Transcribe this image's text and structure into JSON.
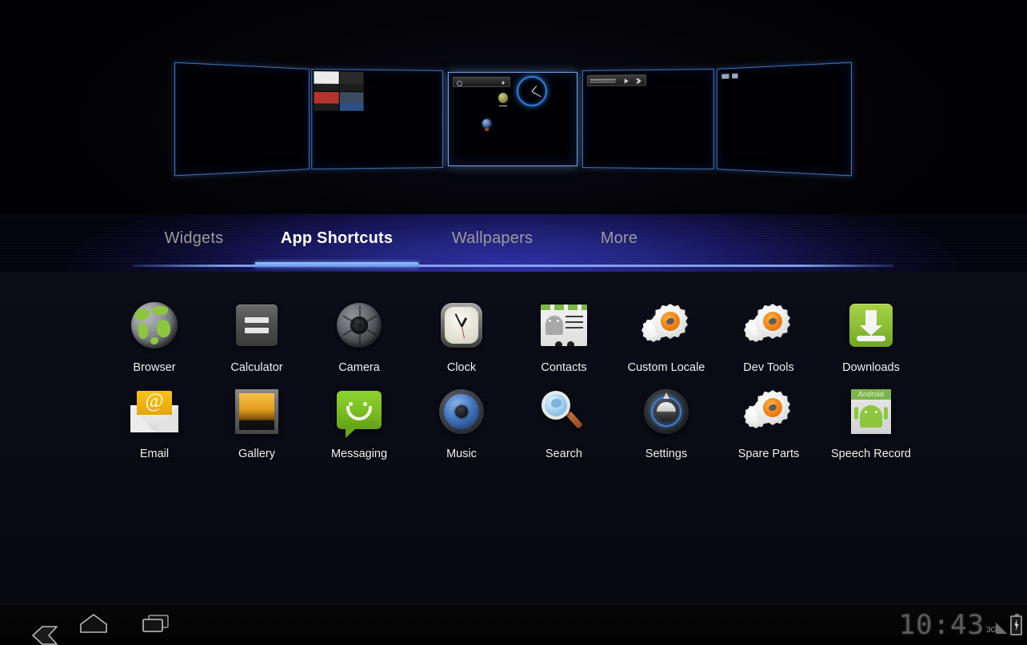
{
  "workspace": {
    "panels": [
      {
        "name": "panel-empty-left",
        "selected": false,
        "widgets": []
      },
      {
        "name": "panel-bookmarks",
        "selected": false,
        "widgets": [
          "bookmarks-grid"
        ]
      },
      {
        "name": "panel-home-current",
        "selected": true,
        "widgets": [
          "search-bar",
          "analog-clock-widget",
          "globe-icon",
          "browser-shortcut"
        ]
      },
      {
        "name": "panel-music",
        "selected": false,
        "widgets": [
          "music-player-widget"
        ]
      },
      {
        "name": "panel-empty-right",
        "selected": false,
        "widgets": []
      }
    ],
    "accent_color": "#3f6fb5",
    "selected_accent_color": "#6ea4e8"
  },
  "tabs": {
    "items": [
      {
        "label": "Widgets",
        "active": false
      },
      {
        "label": "App Shortcuts",
        "active": true
      },
      {
        "label": "Wallpapers",
        "active": false
      },
      {
        "label": "More",
        "active": false
      }
    ],
    "active_color": "#ffffff",
    "inactive_color": "#9b9b9b",
    "underline_color": "#7fb0f5"
  },
  "apps": {
    "rows": [
      [
        {
          "label": "Browser",
          "icon": "browser-icon"
        },
        {
          "label": "Calculator",
          "icon": "calculator-icon"
        },
        {
          "label": "Camera",
          "icon": "camera-icon"
        },
        {
          "label": "Clock",
          "icon": "clock-icon"
        },
        {
          "label": "Contacts",
          "icon": "contacts-icon"
        },
        {
          "label": "Custom Locale",
          "icon": "gear-icon"
        },
        {
          "label": "Dev Tools",
          "icon": "gear-icon"
        },
        {
          "label": "Downloads",
          "icon": "download-icon"
        }
      ],
      [
        {
          "label": "Email",
          "icon": "email-icon"
        },
        {
          "label": "Gallery",
          "icon": "gallery-icon"
        },
        {
          "label": "Messaging",
          "icon": "message-icon"
        },
        {
          "label": "Music",
          "icon": "music-icon"
        },
        {
          "label": "Search",
          "icon": "search-icon"
        },
        {
          "label": "Settings",
          "icon": "settings-icon"
        },
        {
          "label": "Spare Parts",
          "icon": "gear-icon"
        },
        {
          "label": "Speech Record",
          "icon": "android-app-icon"
        }
      ]
    ]
  },
  "widget_previews": {
    "speech_record_caption": "Android"
  },
  "system_bar": {
    "nav": [
      {
        "name": "back-button",
        "icon": "back-chevron-icon"
      },
      {
        "name": "home-button",
        "icon": "home-icon"
      },
      {
        "name": "recents-button",
        "icon": "recent-apps-icon"
      }
    ],
    "clock": "10:43",
    "network": "3G",
    "battery_state": "charging"
  }
}
